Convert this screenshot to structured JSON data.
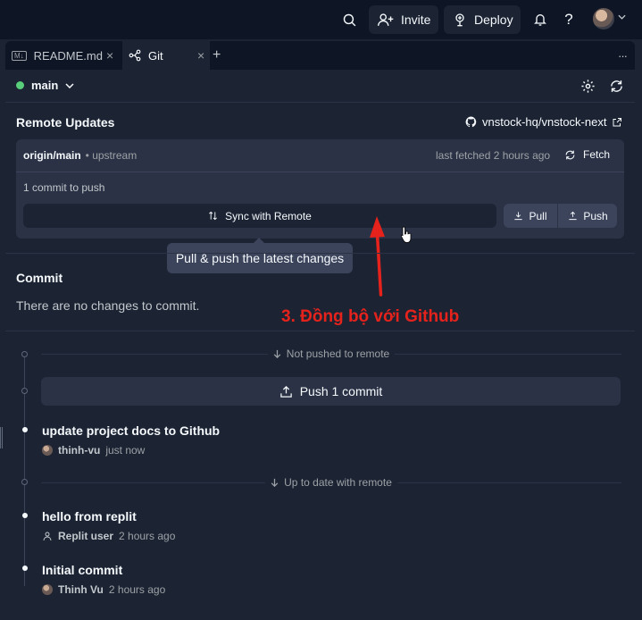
{
  "topbar": {
    "invite_label": "Invite",
    "deploy_label": "Deploy",
    "help_label": "?"
  },
  "tabs": [
    {
      "badge": "M↓",
      "label": "README.md",
      "close": "×"
    },
    {
      "label": "Git",
      "close": "×"
    },
    {
      "label": "+"
    }
  ],
  "tabs_more": "···",
  "branch": {
    "name": "main"
  },
  "remote": {
    "title": "Remote Updates",
    "repo": "vnstock-hq/vnstock-next",
    "tracking_branch": "origin/main",
    "tracking_suffix": "• upstream",
    "last_fetched": "last fetched 2 hours ago",
    "fetch_label": "Fetch",
    "commits_to_push": "1 commit to push",
    "sync_label": "Sync with Remote",
    "pull_label": "Pull",
    "push_label": "Push",
    "tooltip": "Pull & push the latest changes"
  },
  "commit_section": {
    "title": "Commit",
    "empty": "There are no changes to commit."
  },
  "annotation": "3. Đồng bộ với Github",
  "timeline": {
    "not_pushed": "Not pushed to remote",
    "push_button": "Push 1 commit",
    "up_to_date": "Up to date with remote",
    "commits": [
      {
        "message": "update project docs to Github",
        "author": "thinh-vu",
        "time": "just now"
      },
      {
        "message": "hello from replit",
        "author": "Replit user",
        "time": "2 hours ago"
      },
      {
        "message": "Initial commit",
        "author": "Thinh Vu",
        "time": "2 hours ago"
      }
    ]
  },
  "colors": {
    "background": "#1c2333",
    "topbar": "#0e1525",
    "card": "#2b3245",
    "accent_green": "#58ce7a",
    "annotation_red": "#e5231c"
  }
}
